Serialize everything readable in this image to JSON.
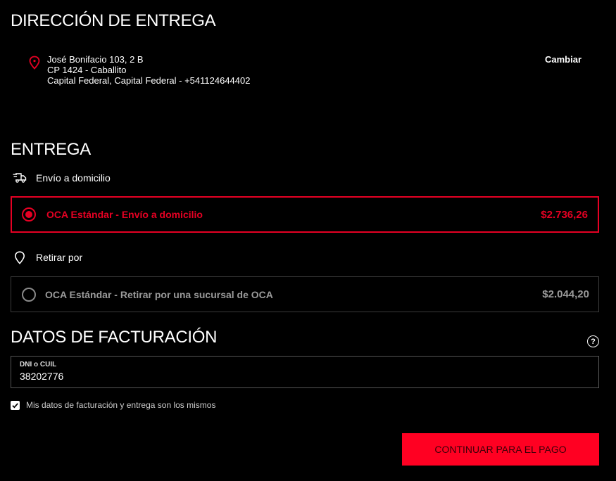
{
  "address_section": {
    "title": "DIRECCIÓN DE ENTREGA",
    "icon": "map-pin-icon",
    "lines": [
      "José Bonifacio 103, 2 B",
      "CP 1424 - Caballito",
      "Capital Federal, Capital Federal - +541124644402"
    ],
    "change_label": "Cambiar"
  },
  "delivery_section": {
    "title": "ENTREGA",
    "home_method": {
      "icon": "truck-icon",
      "label": "Envío a domicilio"
    },
    "pickup_method": {
      "icon": "location-icon",
      "label": "Retirar por"
    },
    "options": [
      {
        "label": "OCA Estándar - Envío a domicilio",
        "price": "$2.736,26",
        "selected": true
      },
      {
        "label": "OCA Estándar - Retirar por una sucursal de OCA",
        "price": "$2.044,20",
        "selected": false
      }
    ]
  },
  "billing_section": {
    "title": "DATOS DE FACTURACIÓN",
    "help_icon": "question-circle-icon",
    "help_glyph": "?",
    "field_label": "DNI o CUIL",
    "field_value": "38202776",
    "same_data_checkbox": {
      "label": "Mis datos de facturación y entrega son los mismos",
      "checked": true
    }
  },
  "cta": {
    "label": "CONTINUAR PARA EL PAGO"
  },
  "colors": {
    "accent": "#e60023",
    "button": "#ff0022",
    "background": "#000000",
    "muted": "#9a9a9a"
  }
}
